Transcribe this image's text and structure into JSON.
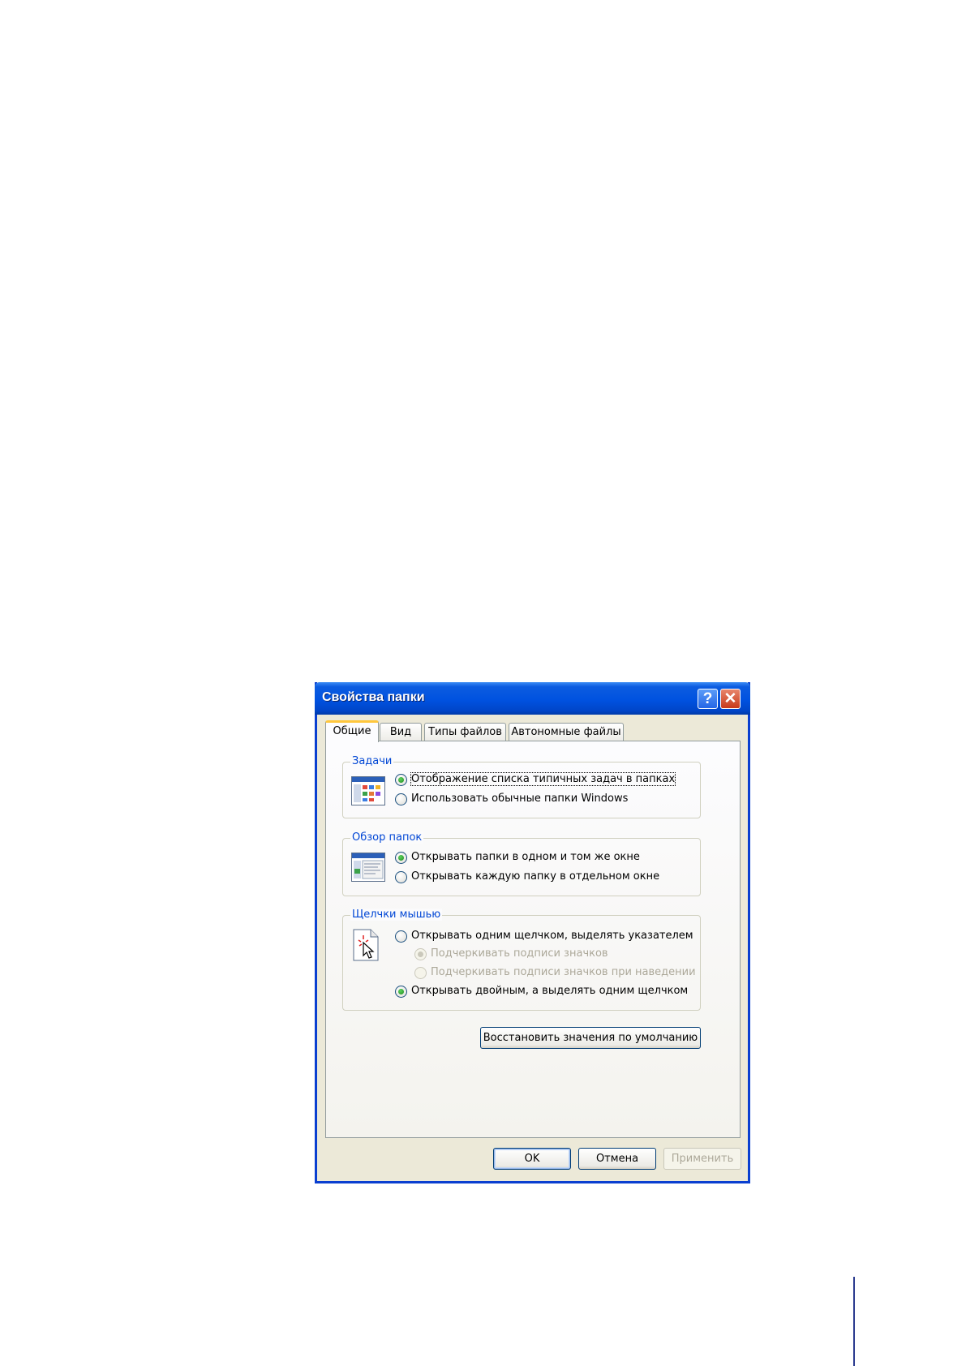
{
  "dialog": {
    "title": "Свойства папки",
    "help_glyph": "?",
    "close_glyph": "✕"
  },
  "tabs": [
    {
      "label": "Общие",
      "active": true
    },
    {
      "label": "Вид",
      "active": false
    },
    {
      "label": "Типы файлов",
      "active": false
    },
    {
      "label": "Автономные файлы",
      "active": false
    }
  ],
  "groups": {
    "tasks": {
      "title": "Задачи",
      "icon": "task-folder-icon",
      "options": [
        {
          "label": "Отображение списка типичных задач в папках",
          "checked": true,
          "enabled": true
        },
        {
          "label": "Использовать обычные папки Windows",
          "checked": false,
          "enabled": true
        }
      ]
    },
    "browse": {
      "title": "Обзор папок",
      "icon": "folder-window-icon",
      "options": [
        {
          "label": "Открывать папки в одном и том же окне",
          "checked": true,
          "enabled": true
        },
        {
          "label": "Открывать каждую папку в отдельном окне",
          "checked": false,
          "enabled": true
        }
      ]
    },
    "clicks": {
      "title": "Щелчки мышью",
      "icon": "cursor-click-icon",
      "options": [
        {
          "label": "Открывать одним щелчком, выделять указателем",
          "checked": false,
          "enabled": true
        },
        {
          "label": "Подчеркивать подписи значков",
          "checked": true,
          "enabled": false
        },
        {
          "label": "Подчеркивать подписи значков при наведении",
          "checked": false,
          "enabled": false
        },
        {
          "label": "Открывать двойным, а выделять одним щелчком",
          "checked": true,
          "enabled": true
        }
      ]
    }
  },
  "buttons": {
    "restore": "Восстановить значения по умолчанию",
    "ok": "OK",
    "cancel": "Отмена",
    "apply": "Применить"
  },
  "colors": {
    "titlebar": "#0052e0",
    "group_title": "#0046d5",
    "active_tab_highlight": "#ffc73c",
    "dialog_face": "#ece9d8",
    "page_rule": "#2b3a8f"
  }
}
